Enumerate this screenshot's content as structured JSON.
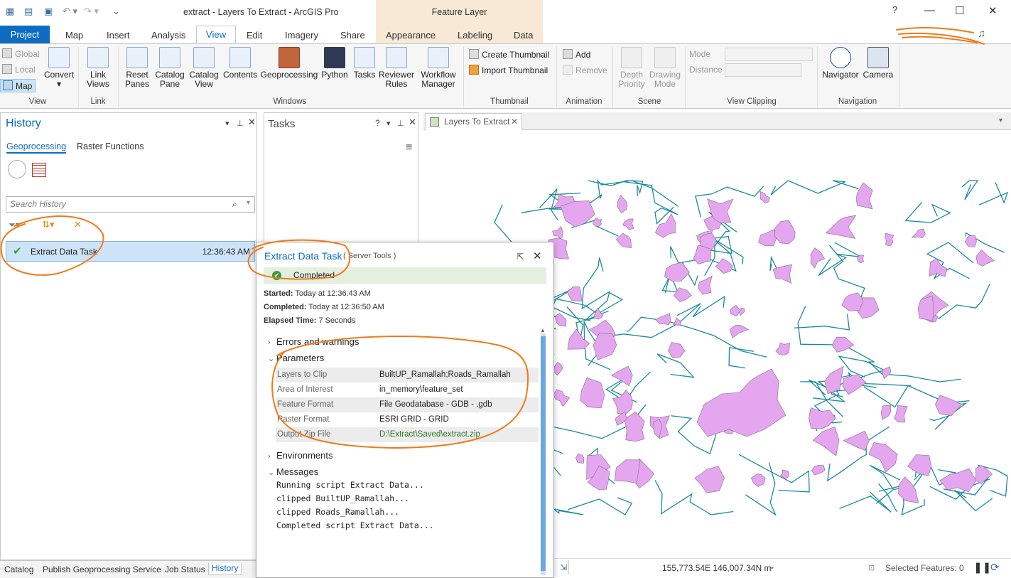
{
  "app": {
    "window_title": "extract - Layers To Extract - ArcGIS Pro",
    "context_header": "Feature Layer"
  },
  "window_controls": {
    "help": "?",
    "minimize": "—",
    "maximize": "☐",
    "close": "✕"
  },
  "tabs": {
    "project": "Project",
    "items": [
      "Map",
      "Insert",
      "Analysis",
      "View",
      "Edit",
      "Imagery",
      "Share"
    ],
    "context_items": [
      "Appearance",
      "Labeling",
      "Data"
    ],
    "active": "View"
  },
  "ribbon": {
    "view_group": {
      "label": "View",
      "global": "Global",
      "local": "Local",
      "map": "Map",
      "convert": "Convert"
    },
    "link_group": {
      "label": "Link",
      "link_views": "Link\nViews"
    },
    "windows_group": {
      "label": "Windows",
      "reset_panes": "Reset\nPanes",
      "catalog_pane": "Catalog\nPane",
      "catalog_view": "Catalog\nView",
      "contents": "Contents",
      "geoprocessing": "Geoprocessing",
      "python": "Python",
      "tasks": "Tasks",
      "reviewer_rules": "Reviewer\nRules",
      "workflow_manager": "Workflow\nManager"
    },
    "thumbnail_group": {
      "label": "Thumbnail",
      "create": "Create Thumbnail",
      "import": "Import Thumbnail"
    },
    "animation_group": {
      "label": "Animation",
      "add": "Add",
      "remove": "Remove"
    },
    "scene_group": {
      "label": "Scene",
      "depth_priority": "Depth\nPriority",
      "drawing_mode": "Drawing\nMode"
    },
    "clipping_group": {
      "label": "View Clipping",
      "mode": "Mode",
      "distance": "Distance"
    },
    "navigation_group": {
      "label": "Navigation",
      "navigator": "Navigator",
      "camera": "Camera"
    }
  },
  "history_pane": {
    "title": "History",
    "subtabs": [
      "Geoprocessing",
      "Raster Functions"
    ],
    "search_placeholder": "Search History",
    "row": {
      "name": "Extract Data Task",
      "time": "12:36:43 AM"
    }
  },
  "tasks_pane": {
    "title": "Tasks"
  },
  "map": {
    "tab_label": "Layers To Extract",
    "coordinates": "155,773.54E 146,007.34N m",
    "selected_features": "Selected Features: 0",
    "colors": {
      "polygon_fill": "#e3a6ef",
      "polygon_stroke": "#8a6a8a",
      "road": "#1a8aa0"
    }
  },
  "popup": {
    "title": "Extract Data Task",
    "subtitle": "( Server Tools )",
    "status": "Completed",
    "started_label": "Started:",
    "started_value": "Today at 12:36:43 AM",
    "completed_label": "Completed:",
    "completed_value": "Today at 12:36:50 AM",
    "elapsed_label": "Elapsed Time:",
    "elapsed_value": "7 Seconds",
    "sections": {
      "errors": "Errors and warnings",
      "parameters": "Parameters",
      "environments": "Environments",
      "messages": "Messages"
    },
    "parameters": [
      {
        "name": "Layers to Clip",
        "value": "BuiltUP_Ramallah;Roads_Ramallah"
      },
      {
        "name": "Area of Interest",
        "value": "in_memory\\feature_set"
      },
      {
        "name": "Feature Format",
        "value": "File Geodatabase - GDB - .gdb"
      },
      {
        "name": "Raster Format",
        "value": "ESRI GRID - GRID"
      },
      {
        "name": "Output Zip File",
        "value": "D:\\Extract\\Saved\\extract.zip"
      }
    ],
    "messages": [
      "Running script Extract Data...",
      "clipped BuiltUP_Ramallah...",
      "clipped Roads_Ramallah...",
      "Completed script Extract Data..."
    ]
  },
  "bottom_tabs": [
    "Catalog",
    "Publish Geoprocessing Service",
    "Job Status",
    "History"
  ],
  "annotation_color": "#f07a1a"
}
